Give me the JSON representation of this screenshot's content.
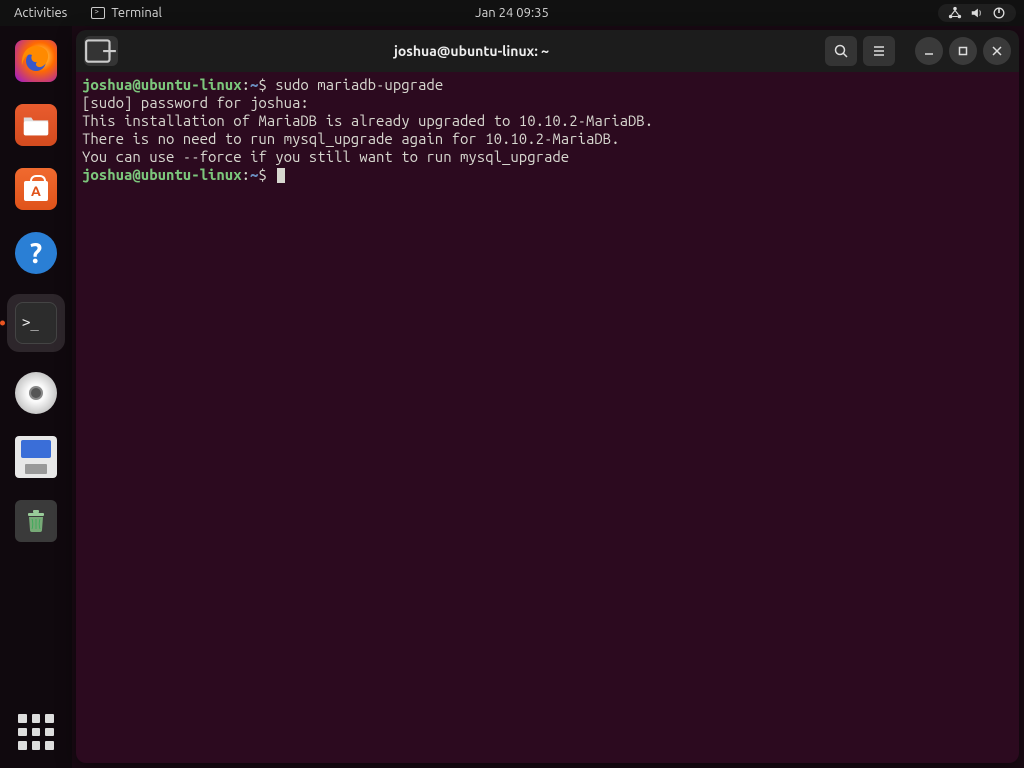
{
  "topbar": {
    "activities": "Activities",
    "app_label": "Terminal",
    "datetime": "Jan 24  09:35"
  },
  "dock": {
    "items": [
      {
        "name": "firefox"
      },
      {
        "name": "files"
      },
      {
        "name": "software"
      },
      {
        "name": "help"
      },
      {
        "name": "terminal",
        "active": true
      },
      {
        "name": "disc"
      },
      {
        "name": "floppy"
      },
      {
        "name": "trash"
      }
    ]
  },
  "window": {
    "title": "joshua@ubuntu-linux: ~"
  },
  "terminal": {
    "prompt1_user": "joshua@ubuntu-linux",
    "prompt1_sep": ":",
    "prompt1_path": "~",
    "prompt1_sym": "$ ",
    "command1": "sudo mariadb-upgrade",
    "line1": "[sudo] password for joshua: ",
    "line2": "This installation of MariaDB is already upgraded to 10.10.2-MariaDB.",
    "line3": "There is no need to run mysql_upgrade again for 10.10.2-MariaDB.",
    "line4": "You can use --force if you still want to run mysql_upgrade",
    "prompt2_user": "joshua@ubuntu-linux",
    "prompt2_sep": ":",
    "prompt2_path": "~",
    "prompt2_sym": "$ "
  }
}
